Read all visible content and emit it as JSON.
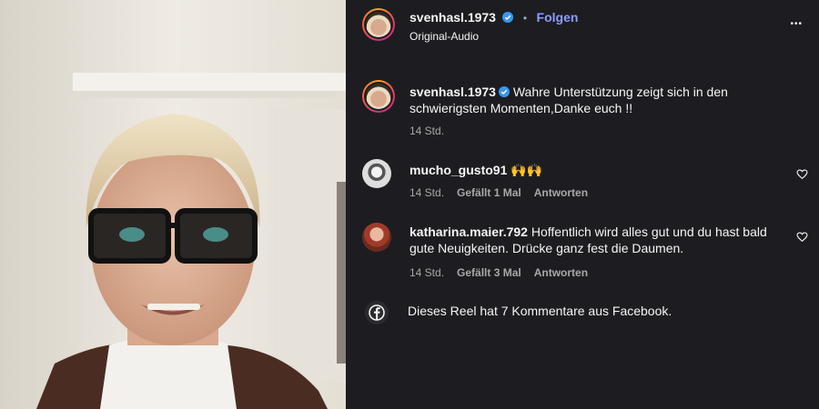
{
  "header": {
    "username": "svenhasl.1973",
    "follow_label": "Folgen",
    "dot": "•",
    "audio": "Original-Audio",
    "more_label": "•••"
  },
  "caption": {
    "username": "svenhasl.1973",
    "text": "Wahre Unterstützung zeigt sich in den schwierigsten Momenten,Danke euch !!",
    "time": "14 Std."
  },
  "comments": [
    {
      "username": "mucho_gusto91",
      "text": "🙌🙌",
      "time": "14 Std.",
      "likes": "Gefällt 1 Mal",
      "reply": "Antworten"
    },
    {
      "username": "katharina.maier.792",
      "text": "Hoffentlich wird alles gut und du hast bald gute Neuigkeiten. Drücke ganz fest die Daumen.",
      "time": "14 Std.",
      "likes": "Gefällt 3 Mal",
      "reply": "Antworten"
    }
  ],
  "facebook_notice": "Dieses Reel hat 7 Kommentare aus Facebook.",
  "colors": {
    "background": "#1d1d21",
    "follow": "#8c9cff",
    "verified": "#3897f0",
    "secondary_text": "#a8a8a8"
  }
}
